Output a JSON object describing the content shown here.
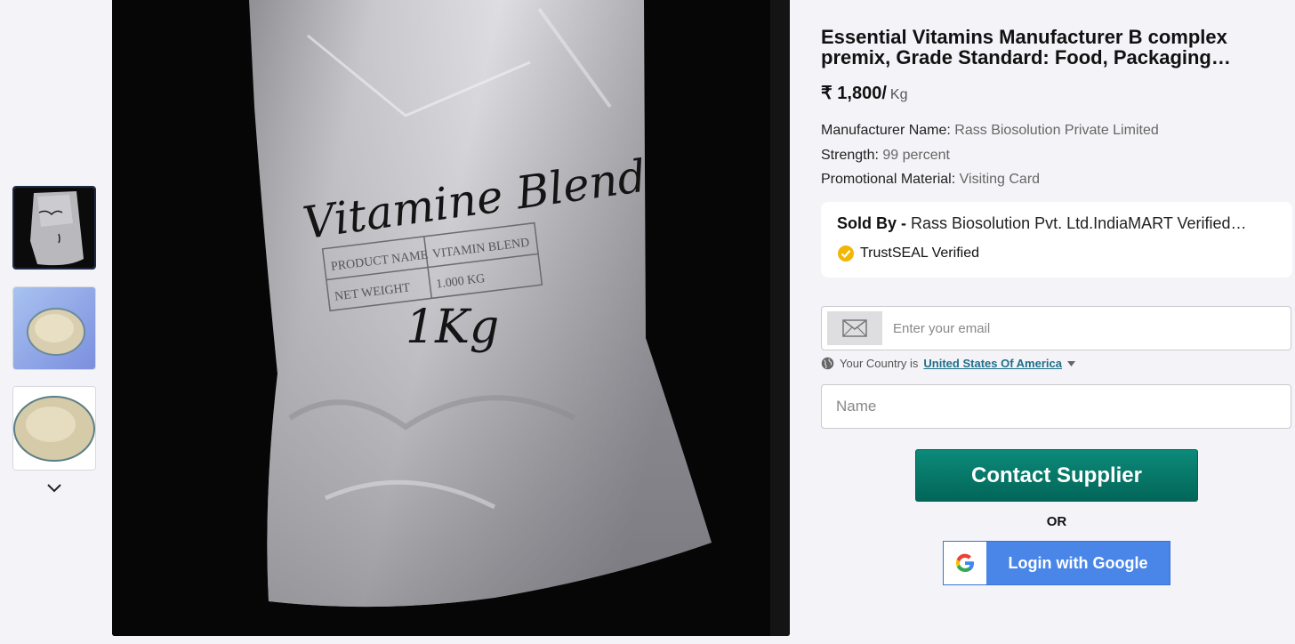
{
  "product": {
    "title": "Essential Vitamins Manufacturer B complex premix, Grade Standard: Food, Packaging…",
    "price": "₹ 1,800/",
    "unit": "Kg",
    "specs": [
      {
        "label": "Manufacturer Name:",
        "value": "Rass Biosolution Private Limited"
      },
      {
        "label": "Strength:",
        "value": "99 percent"
      },
      {
        "label": "Promotional Material:",
        "value": "Visiting Card"
      }
    ]
  },
  "seller": {
    "sold_by_label": "Sold By -",
    "name": "Rass Biosolution Pvt. Ltd.IndiaMART Verified…",
    "trust_label": "TrustSEAL Verified"
  },
  "form": {
    "email_placeholder": "Enter your email",
    "country_prefix": "Your Country is",
    "country": "United States Of America",
    "name_placeholder": "Name",
    "contact_button": "Contact Supplier",
    "or_label": "OR",
    "google_button": "Login with Google"
  },
  "image_text": {
    "handwriting": "Vitamine Blend",
    "row1_label": "PRODUCT NAME",
    "row1_value": "VITAMIN BLEND",
    "row2_label": "NET WEIGHT",
    "row2_value": "1.000 KG",
    "weight_note": "1Kg"
  },
  "colors": {
    "accent": "#04786a",
    "google_blue": "#4a86e8",
    "link": "#1e6f8a",
    "trust_gold": "#f2b705"
  },
  "icons": [
    "mail-icon",
    "globe-icon",
    "chevron-down-icon",
    "trustseal-icon",
    "google-icon",
    "caret-down-icon"
  ]
}
